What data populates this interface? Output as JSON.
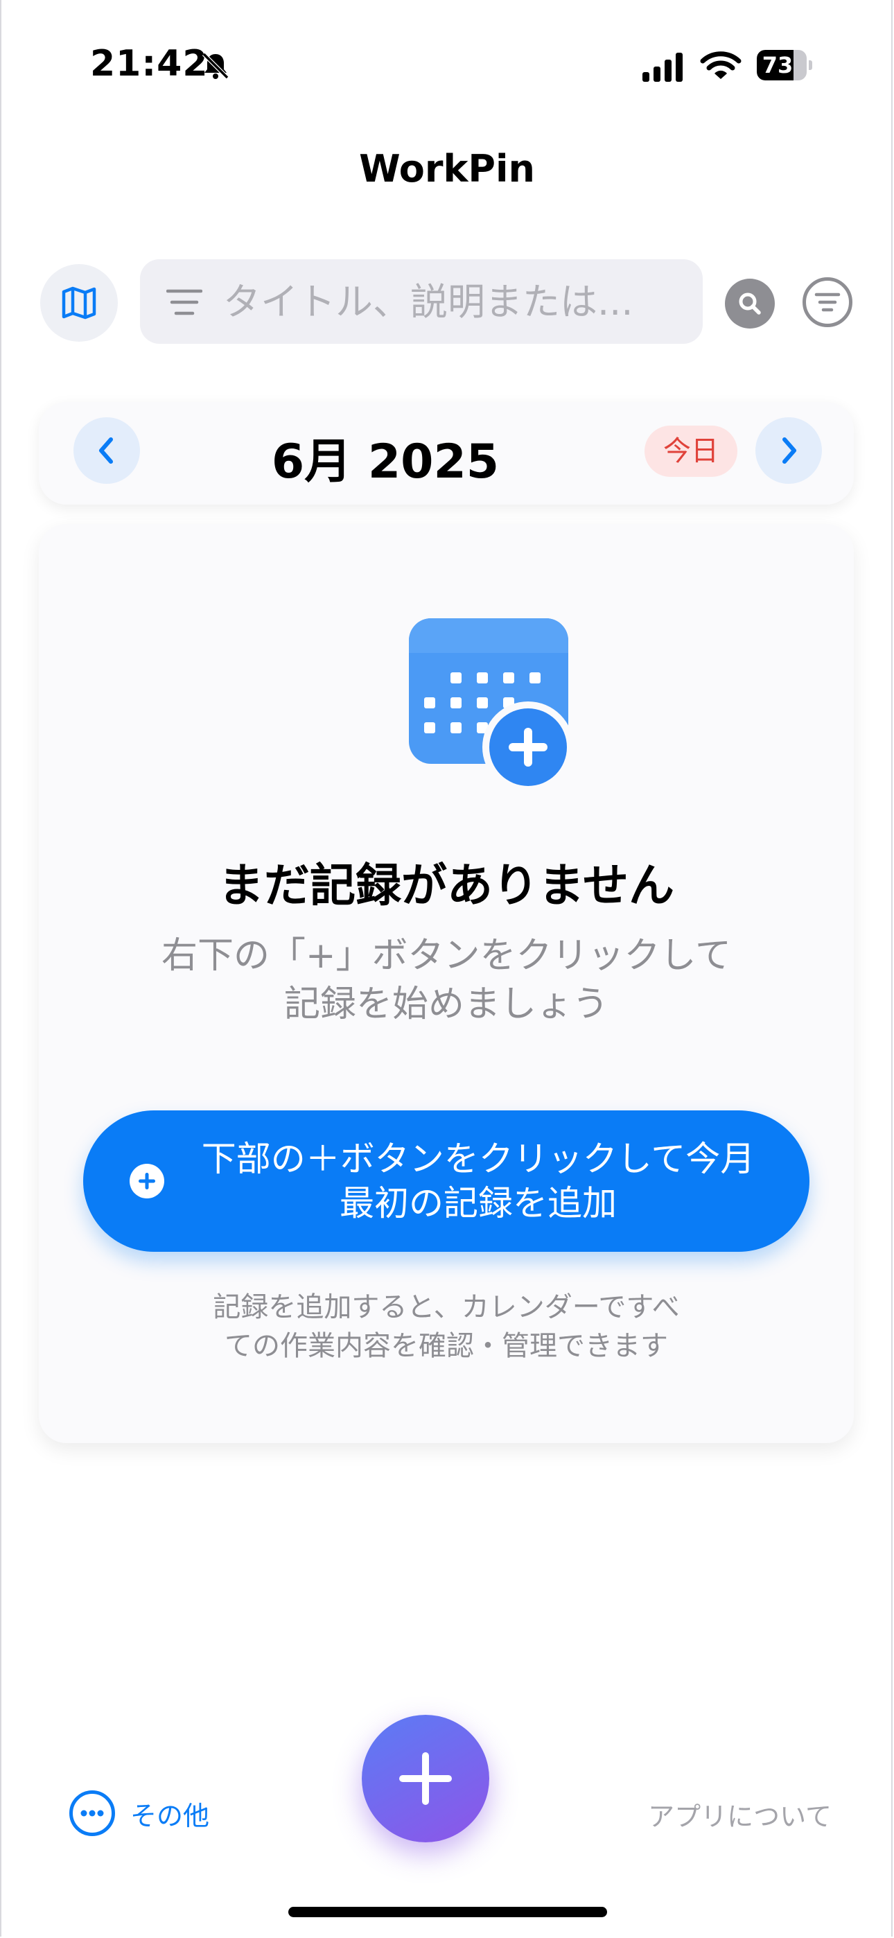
{
  "status_bar": {
    "time": "21:42",
    "battery_level": 73,
    "battery_text": "73",
    "icons": [
      "bell-slash-icon",
      "cellular-signal-icon",
      "wifi-icon",
      "battery-icon"
    ]
  },
  "app": {
    "title": "WorkPin"
  },
  "toolbar": {
    "map_icon": "map-icon",
    "search_placeholder": "タイトル、説明または...",
    "search_icon": "magnifier-icon",
    "filter_icon": "filter-icon"
  },
  "calendar": {
    "month_title": "6月 2025",
    "today_label": "今日",
    "prev_icon": "chevron-left-icon",
    "next_icon": "chevron-right-icon"
  },
  "empty_state": {
    "icon": "calendar-add-icon",
    "title": "まだ記録がありません",
    "subtitle_line1": "右下の「+」ボタンをクリックして",
    "subtitle_line2": "記録を始めましょう",
    "button_line1": "下部の＋ボタンをクリックして今月",
    "button_line2": "最初の記録を追加",
    "hint_line1": "記録を追加すると、カレンダーですべ",
    "hint_line2": "ての作業内容を確認・管理できます"
  },
  "bottom_bar": {
    "more_label": "その他",
    "about_label": "アプリについて",
    "fab_icon": "plus-icon"
  },
  "colors": {
    "accent": "#0a7cf6",
    "today_badge_bg": "#fde4e4",
    "today_badge_text": "#e0423a",
    "fab_gradient_start": "#5b7cf5",
    "fab_gradient_end": "#8e55e8",
    "secondary_text": "#8e8e93"
  }
}
